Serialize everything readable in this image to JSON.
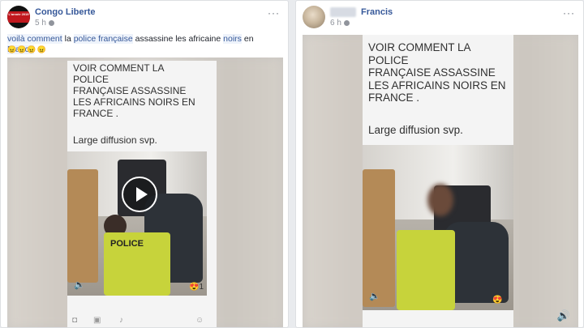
{
  "posts": [
    {
      "author": "Congo Liberte",
      "time": "5 h",
      "avatar_text": "L'année 2019",
      "more": "···",
      "caption_parts": [
        {
          "t": "voilà comment",
          "hl": true
        },
        {
          "t": " la ",
          "hl": false
        },
        {
          "t": "police française",
          "hl": true
        },
        {
          "t": " assassine les africaine ",
          "hl": false
        },
        {
          "t": "noirs",
          "hl": true
        },
        {
          "t": " en ",
          "hl": false
        },
        {
          "t": "France",
          "hl": true
        }
      ],
      "caption_emojis": "😠😠😠😠",
      "phone_text": "VOIR COMMENT LA\nPOLICE\nFRANÇAISE ASSASSINE\nLES AFRICAINS NOIRS EN\nFRANCE .",
      "phone_subtext": "Large diffusion svp.",
      "vest_label": "POLICE",
      "reaction_count": "1",
      "reaction_emoji": "😍",
      "speaker_icon": "🔈"
    },
    {
      "author": "Francis",
      "time": "6 h",
      "more": "···",
      "phone_text": "VOIR COMMENT LA\nPOLICE\nFRANÇAISE ASSASSINE\nLES AFRICAINS NOIRS EN\nFRANCE .",
      "phone_subtext": "Large diffusion svp.",
      "reaction_count": "1",
      "reaction_emoji": "😍",
      "speaker_icon": "🔈",
      "video_speaker_icon": "🔊"
    }
  ]
}
